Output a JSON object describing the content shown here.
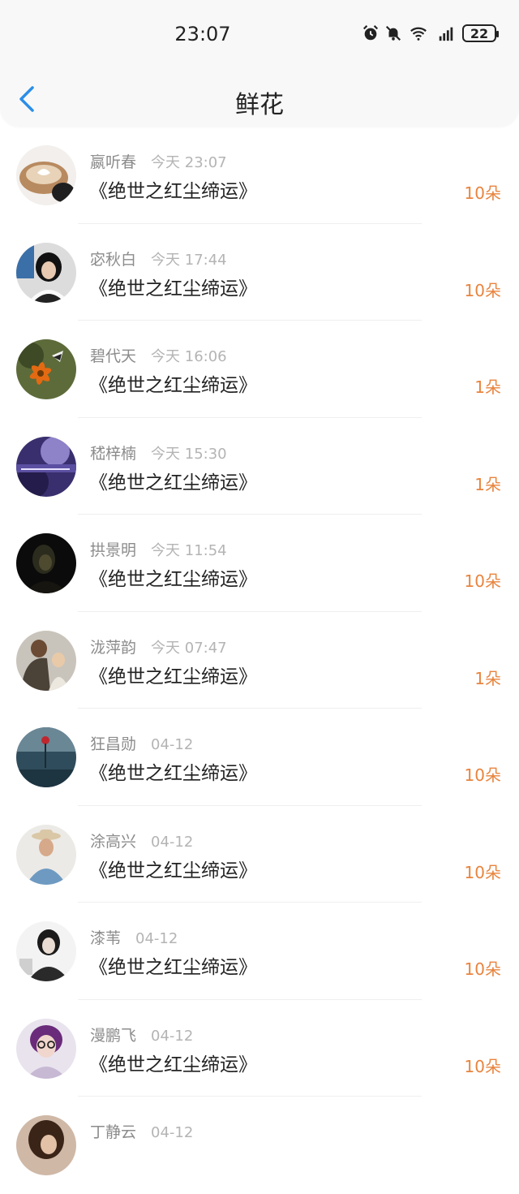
{
  "status_bar": {
    "time": "23:07",
    "battery": "22"
  },
  "header": {
    "title": "鲜花"
  },
  "theme": {
    "accent": "#2b8ee8",
    "amount_color": "#e8843e"
  },
  "items": [
    {
      "name": "嬴听春",
      "time": "今天 23:07",
      "book": "《绝世之红尘缔运》",
      "amount": "10朵"
    },
    {
      "name": "宓秋白",
      "time": "今天 17:44",
      "book": "《绝世之红尘缔运》",
      "amount": "10朵"
    },
    {
      "name": "碧代天",
      "time": "今天 16:06",
      "book": "《绝世之红尘缔运》",
      "amount": "1朵"
    },
    {
      "name": "嵇梓楠",
      "time": "今天 15:30",
      "book": "《绝世之红尘缔运》",
      "amount": "1朵"
    },
    {
      "name": "拱景明",
      "time": "今天 11:54",
      "book": "《绝世之红尘缔运》",
      "amount": "10朵"
    },
    {
      "name": "泷萍韵",
      "time": "今天 07:47",
      "book": "《绝世之红尘缔运》",
      "amount": "1朵"
    },
    {
      "name": "狂昌勋",
      "time": "04-12",
      "book": "《绝世之红尘缔运》",
      "amount": "10朵"
    },
    {
      "name": "涂高兴",
      "time": "04-12",
      "book": "《绝世之红尘缔运》",
      "amount": "10朵"
    },
    {
      "name": "漆苇",
      "time": "04-12",
      "book": "《绝世之红尘缔运》",
      "amount": "10朵"
    },
    {
      "name": "漫鹏飞",
      "time": "04-12",
      "book": "《绝世之红尘缔运》",
      "amount": "10朵"
    },
    {
      "name": "丁静云",
      "time": "04-12",
      "book": "",
      "amount": ""
    }
  ]
}
